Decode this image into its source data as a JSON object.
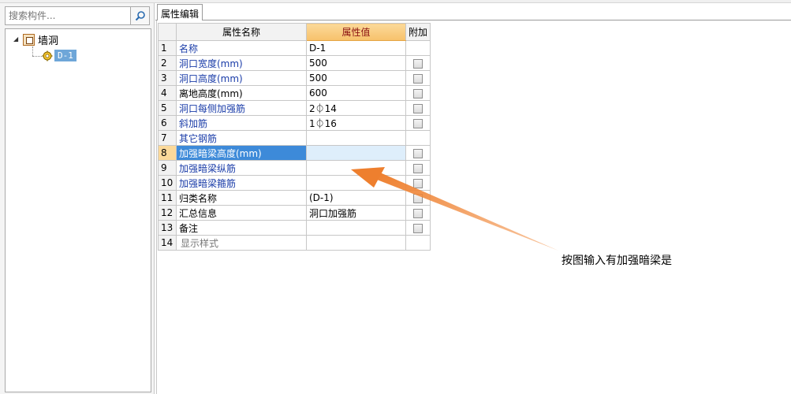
{
  "search": {
    "placeholder": "搜索构件..."
  },
  "tree": {
    "root_label": "墙洞",
    "child_label": "D-1"
  },
  "tab": {
    "label": "属性编辑"
  },
  "table": {
    "headers": {
      "name": "属性名称",
      "value": "属性值",
      "extra": "附加"
    },
    "rows": [
      {
        "num": "1",
        "name": "名称",
        "value": "D-1",
        "checkbox": false
      },
      {
        "num": "2",
        "name": "洞口宽度(mm)",
        "value": "500",
        "checkbox": true
      },
      {
        "num": "3",
        "name": "洞口高度(mm)",
        "value": "500",
        "checkbox": true
      },
      {
        "num": "4",
        "name": "离地高度(mm)",
        "value": "600",
        "checkbox": true
      },
      {
        "num": "5",
        "name": "洞口每侧加强筋",
        "value": "2⏀14",
        "checkbox": true
      },
      {
        "num": "6",
        "name": "斜加筋",
        "value": "1⏀16",
        "checkbox": true
      },
      {
        "num": "7",
        "name": "其它钢筋",
        "value": "",
        "checkbox": false
      },
      {
        "num": "8",
        "name": "加强暗梁高度(mm)",
        "value": "",
        "checkbox": true
      },
      {
        "num": "9",
        "name": "加强暗梁纵筋",
        "value": "",
        "checkbox": true
      },
      {
        "num": "10",
        "name": "加强暗梁箍筋",
        "value": "",
        "checkbox": true
      },
      {
        "num": "11",
        "name": "归类名称",
        "value": "(D-1)",
        "checkbox": true
      },
      {
        "num": "12",
        "name": "汇总信息",
        "value": "洞口加强筋",
        "checkbox": true
      },
      {
        "num": "13",
        "name": "备注",
        "value": "",
        "checkbox": true
      },
      {
        "num": "14",
        "name": "显示样式",
        "value": "",
        "checkbox": false
      }
    ]
  },
  "annotation": {
    "text": "按图输入有加强暗梁是"
  },
  "colors": {
    "accent": "#3d8ad9",
    "header_highlight": "#f7c16b",
    "arrow": "#f08a3c",
    "property_text": "#1a3ca8"
  },
  "icons": {
    "search": "search-icon",
    "wall": "wall-opening-icon",
    "gear": "gear-icon",
    "expand": "plus-icon"
  }
}
